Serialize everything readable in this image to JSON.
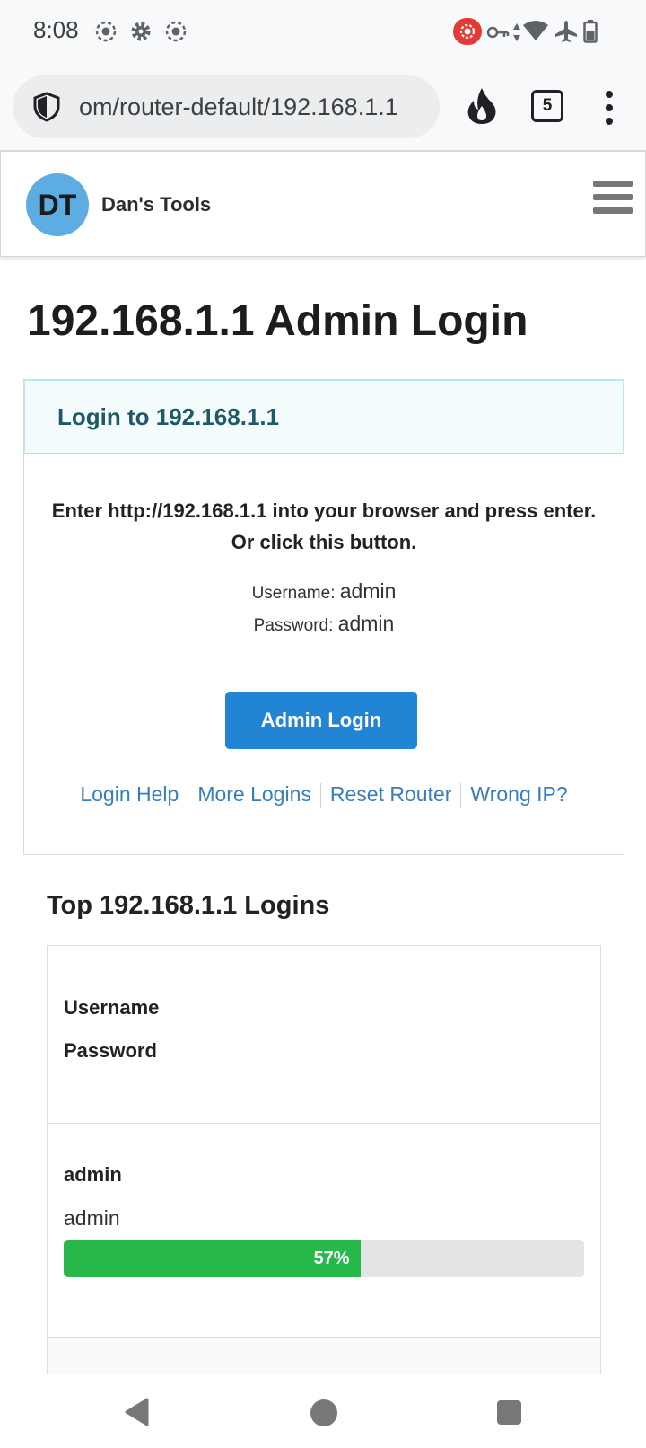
{
  "status_bar": {
    "time": "8:08",
    "left_icons": [
      "screen-record-icon",
      "settings-gear-icon",
      "screen-record-icon"
    ],
    "right_icons": [
      "recording-indicator-icon",
      "vpn-key-icon",
      "data-arrows-icon",
      "wifi-icon",
      "airplane-mode-icon",
      "battery-icon"
    ],
    "record_color": "#e53935"
  },
  "browser": {
    "url": "om/router-default/192.168.1.1",
    "tab_count": "5"
  },
  "site": {
    "logo_initials": "DT",
    "brand_name": "Dan's Tools",
    "logo_color": "#5dade2"
  },
  "page": {
    "title": "192.168.1.1 Admin Login"
  },
  "login_card": {
    "heading": "Login to 192.168.1.1",
    "instructions": "Enter http://192.168.1.1 into your browser and press enter. Or click this button.",
    "username_label": "Username:",
    "username_value": "admin",
    "password_label": "Password:",
    "password_value": "admin",
    "button_label": "Admin Login",
    "button_color": "#2284d4",
    "links": [
      "Login Help",
      "More Logins",
      "Reset Router",
      "Wrong IP?"
    ]
  },
  "top_logins": {
    "heading": "Top 192.168.1.1 Logins",
    "col_username": "Username",
    "col_password": "Password",
    "rows": [
      {
        "username": "admin",
        "password": "admin",
        "percent": 57,
        "percent_label": "57%"
      }
    ],
    "bar_color": "#28b84a"
  }
}
